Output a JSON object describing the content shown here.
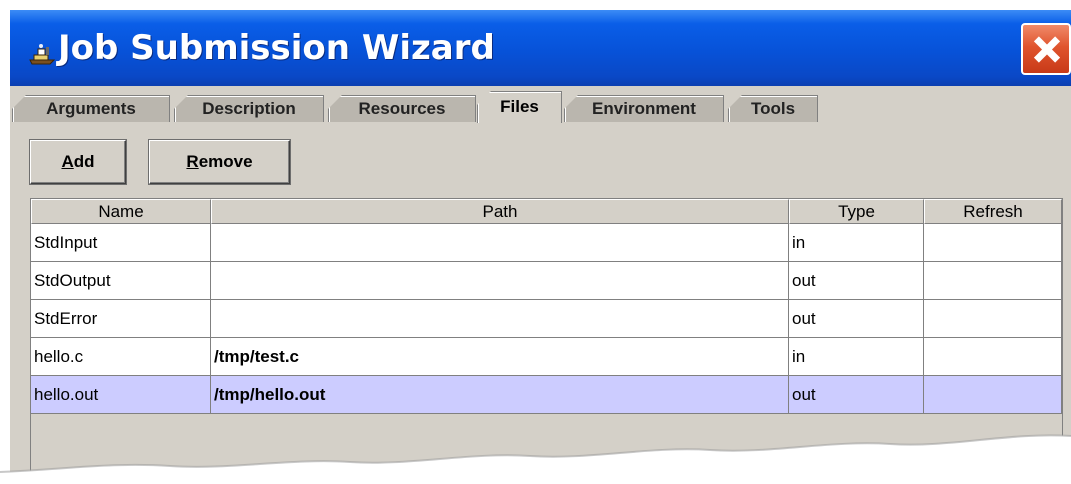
{
  "window": {
    "title": "Job Submission Wizard"
  },
  "tabs": [
    {
      "label": "Arguments",
      "active": false
    },
    {
      "label": "Description",
      "active": false
    },
    {
      "label": "Resources",
      "active": false
    },
    {
      "label": "Files",
      "active": true
    },
    {
      "label": "Environment",
      "active": false
    },
    {
      "label": "Tools",
      "active": false
    }
  ],
  "toolbar": {
    "add_mnemonic": "A",
    "add_rest": "dd",
    "remove_mnemonic": "R",
    "remove_rest": "emove"
  },
  "table": {
    "columns": [
      "Name",
      "Path",
      "Type",
      "Refresh"
    ],
    "rows": [
      {
        "name": "StdInput",
        "path": "",
        "type": "in",
        "refresh": ""
      },
      {
        "name": "StdOutput",
        "path": "",
        "type": "out",
        "refresh": ""
      },
      {
        "name": "StdError",
        "path": "",
        "type": "out",
        "refresh": ""
      },
      {
        "name": "hello.c",
        "path": "/tmp/test.c",
        "type": "in",
        "refresh": ""
      },
      {
        "name": "hello.out",
        "path": "/tmp/hello.out",
        "type": "out",
        "refresh": "",
        "selected": true,
        "browse_label": "..."
      }
    ]
  },
  "colors": {
    "titlebar": "#0752d8",
    "close_button": "#e0542e",
    "window_face": "#d4d0c8",
    "selected_row": "#ccccff"
  },
  "icons": [
    "app-icon",
    "close-icon",
    "browse-ellipsis-icon"
  ]
}
